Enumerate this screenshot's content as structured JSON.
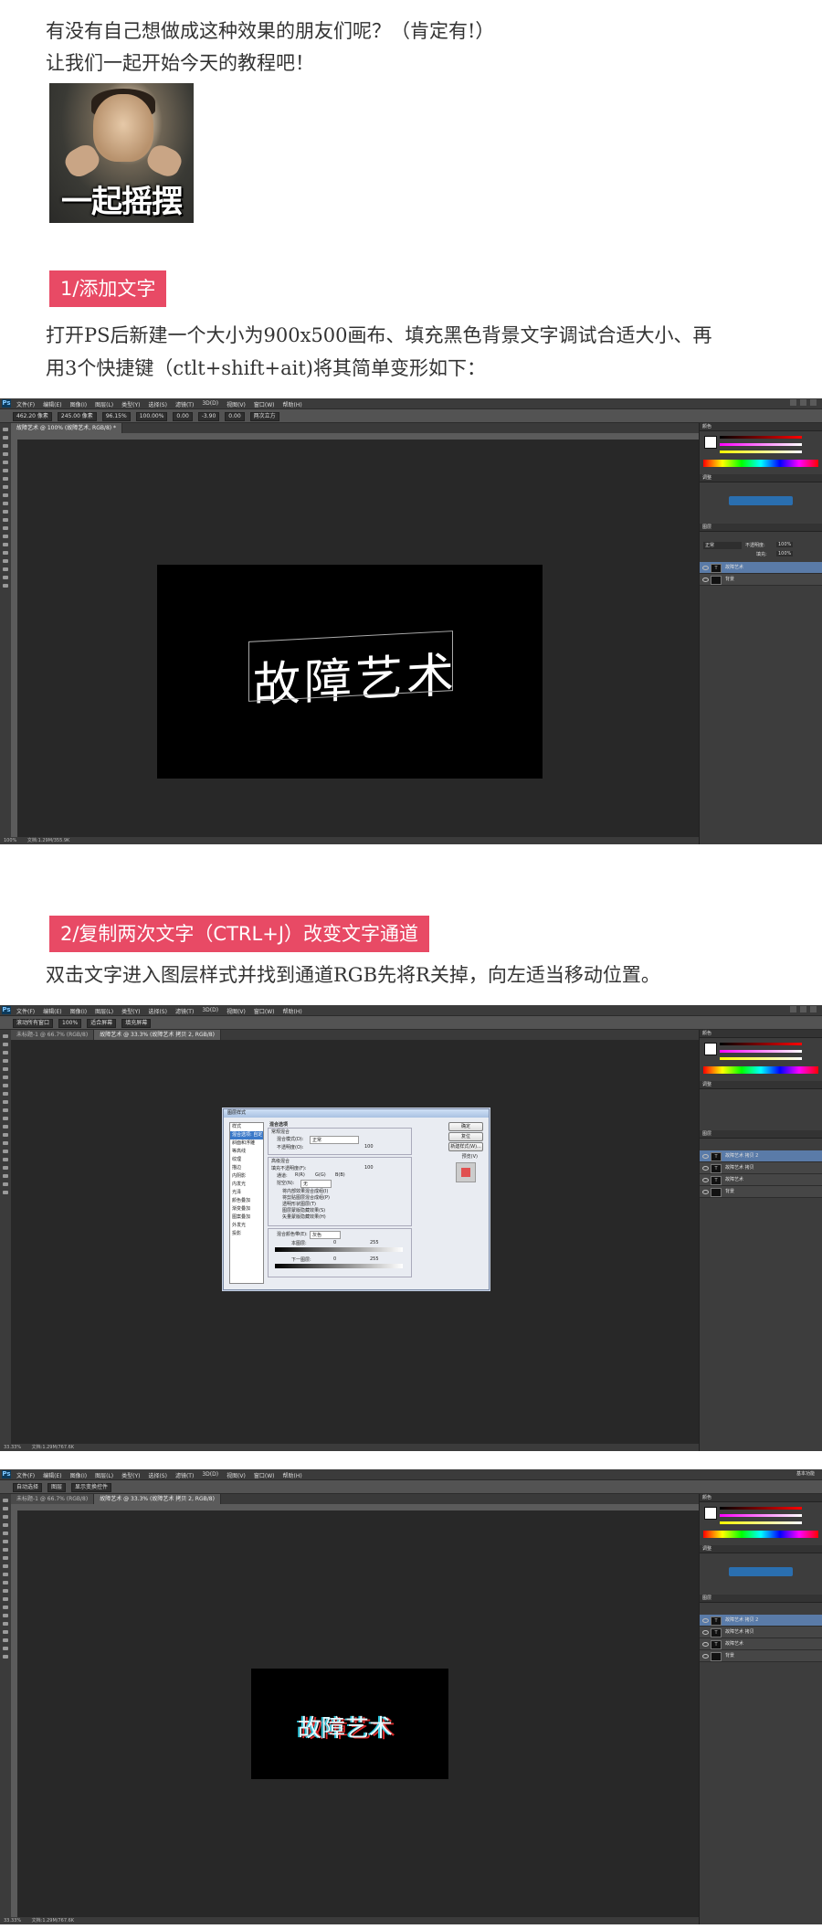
{
  "intro": {
    "line1": "有没有自己想做成这种效果的朋友们呢？（肯定有!）",
    "line2": "让我们一起开始今天的教程吧！",
    "gif_caption": "一起摇摆"
  },
  "step1": {
    "title": "1/添加文字",
    "text1": "打开PS后新建一个大小为900x500画布、填充黑色背景文字调试合适大小、再",
    "text2": "用3个快捷键（ctlt+shift+ait)将其简单变形如下："
  },
  "step2": {
    "title": "2/复制两次文字（CTRL+J）改变文字通道",
    "text1": "双击文字进入图层样式并找到通道RGB先将R关掉，向左适当移动位置。"
  },
  "ps": {
    "logo": "Ps",
    "menu": [
      "文件(F)",
      "编辑(E)",
      "图像(I)",
      "图层(L)",
      "类型(Y)",
      "选择(S)",
      "滤镜(T)",
      "3D(D)",
      "视图(V)",
      "窗口(W)",
      "帮助(H)"
    ],
    "workspace": "基本功能",
    "canvas_text": "故障艺术",
    "s1": {
      "options": [
        "462.20 像素",
        "245.00 像素",
        "96.15%",
        "100.00%",
        "0.00",
        "-3.90",
        "0.00",
        "两次立方"
      ],
      "tab": "故障艺术 @ 100% (故障艺术, RGB/8) *",
      "status_zoom": "100%",
      "status_doc": "文档:1.29M/355.9K",
      "layers": [
        "故障艺术",
        "背景"
      ],
      "blend": "正常",
      "opacity_label": "不透明度:",
      "opacity": "100%",
      "fill_label": "填充:",
      "fill": "100%"
    },
    "s2": {
      "options": [
        "自动选择",
        "图层",
        "显示变换控件"
      ],
      "tabs": [
        "滚动所有窗口",
        "100%",
        "适合屏幕",
        "填充屏幕"
      ],
      "layers": [
        "故障艺术 拷贝 2",
        "故障艺术 拷贝",
        "故障艺术",
        "背景"
      ],
      "status_zoom": "33.33%",
      "status_doc": "文档:1.29M/767.6K",
      "dialog": {
        "title": "图层样式",
        "list": [
          "样式",
          "混合选项: 自定",
          "斜面和浮雕",
          "等高线",
          "纹理",
          "描边",
          "内阴影",
          "内发光",
          "光泽",
          "颜色叠加",
          "渐变叠加",
          "图案叠加",
          "外发光",
          "投影"
        ],
        "section": "混合选项",
        "general": "常规混合",
        "blend_mode_label": "混合模式(D):",
        "blend_mode": "正常",
        "opacity_label": "不透明度(O):",
        "opacity": "100",
        "advanced": "高级混合",
        "fill_label": "填充不透明度(F):",
        "fill": "100",
        "channels_label": "通道:",
        "channels": [
          "R(R)",
          "G(G)",
          "B(B)"
        ],
        "knockout_label": "挖空(N):",
        "knockout": "无",
        "checks": [
          "将内部效果混合成组(I)",
          "将剪贴图层混合成组(P)",
          "透明形状图层(T)",
          "图层蒙版隐藏效果(S)",
          "矢量蒙版隐藏效果(H)"
        ],
        "blendif_label": "混合颜色带(E):",
        "blendif": "灰色",
        "this_layer": "本图层:",
        "under_layer": "下一图层:",
        "range": [
          "0",
          "255"
        ],
        "buttons": [
          "确定",
          "复位",
          "新建样式(W)...",
          "预览(V)"
        ]
      }
    },
    "s3": {
      "tabs": [
        "未标题-1 @ 66.7% (RGB/8)",
        "故障艺术 @ 33.3% (故障艺术 拷贝 2, RGB/8)"
      ],
      "layers": [
        "故障艺术 拷贝 2",
        "故障艺术 拷贝",
        "故障艺术",
        "背景"
      ],
      "status_zoom": "33.33%",
      "status_doc": "文档:1.29M/767.6K"
    }
  },
  "colors": {
    "accent": "#e84a65",
    "ps_bg": "#282828",
    "panel": "#3d3d3d",
    "layer_selected": "#5a7ba8"
  }
}
